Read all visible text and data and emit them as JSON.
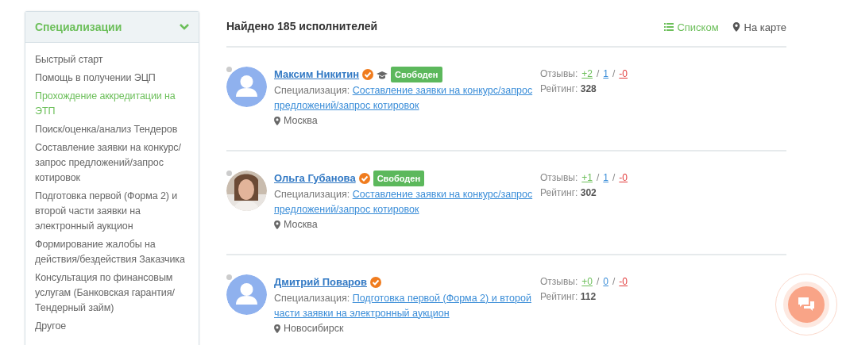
{
  "sidebar": {
    "title": "Специализации",
    "expanded": true,
    "items": [
      {
        "label": "Быстрый старт",
        "selected": false
      },
      {
        "label": "Помощь в получении ЭЦП",
        "selected": false
      },
      {
        "label": "Прохождение аккредитации на ЭТП",
        "selected": true
      },
      {
        "label": "Поиск/оценка/анализ Тендеров",
        "selected": false
      },
      {
        "label": "Составление заявки на конкурс/ запрос предложений/запрос котировок",
        "selected": false
      },
      {
        "label": "Подготовка первой (Форма 2) и второй части заявки на электронный аукцион",
        "selected": false
      },
      {
        "label": "Формирование жалобы на действия/бездействия Заказчика",
        "selected": false
      },
      {
        "label": "Консультация по финансовым услугам (Банковская гарантия/ Тендерный займ)",
        "selected": false
      },
      {
        "label": "Другое",
        "selected": false
      }
    ]
  },
  "results": {
    "title": "Найдено 185 исполнителей",
    "views": [
      {
        "label": "Списком",
        "kind": "list",
        "selected": true
      },
      {
        "label": "На карте",
        "kind": "map",
        "selected": false
      }
    ]
  },
  "executors": [
    {
      "name": "Максим Никитин",
      "avatar": {
        "kind": "placeholder"
      },
      "online": false,
      "verified": true,
      "education": true,
      "status": "Свободен",
      "spec_label": "Специализация:",
      "spec": "Составление заявки на конкурс/запрос предложений/запрос котировок",
      "city": "Москва",
      "reviews_label": "Отзывы:",
      "reviews": [
        {
          "kind": "positive",
          "text": "+2"
        },
        {
          "kind": "separator",
          "text": "/"
        },
        {
          "kind": "neutral",
          "text": "1"
        },
        {
          "kind": "separator",
          "text": "/"
        },
        {
          "kind": "negative",
          "text": "-0"
        }
      ],
      "rating_label": "Рейтинг:",
      "rating": "328"
    },
    {
      "name": "Ольга Губанова",
      "online": false,
      "verified": true,
      "status": "Свободен",
      "spec_label": "Специализация:",
      "spec": "Составление заявки на конкурс/запрос предложений/запрос котировок",
      "city": "Москва",
      "reviews_label": "Отзывы:",
      "reviews": [
        {
          "kind": "positive",
          "text": "+1"
        },
        {
          "kind": "separator",
          "text": "/"
        },
        {
          "kind": "neutral",
          "text": "1"
        },
        {
          "kind": "separator",
          "text": "/"
        },
        {
          "kind": "negative",
          "text": "-0"
        }
      ],
      "rating_label": "Рейтинг:",
      "rating": "302"
    },
    {
      "name": "Дмитрий Поваров",
      "avatar": {
        "kind": "placeholder"
      },
      "online": false,
      "verified": true,
      "spec_label": "Специализация:",
      "spec": "Подготовка первой (Форма 2) и второй части заявки на электронный аукцион",
      "city": "Новосибирск",
      "reviews_label": "Отзывы:",
      "reviews": [
        {
          "kind": "positive",
          "text": "+0"
        },
        {
          "kind": "separator",
          "text": "/"
        },
        {
          "kind": "neutral",
          "text": "0"
        },
        {
          "kind": "separator",
          "text": "/"
        },
        {
          "kind": "negative",
          "text": "-0"
        }
      ],
      "rating_label": "Рейтинг:",
      "rating": "112"
    }
  ]
}
